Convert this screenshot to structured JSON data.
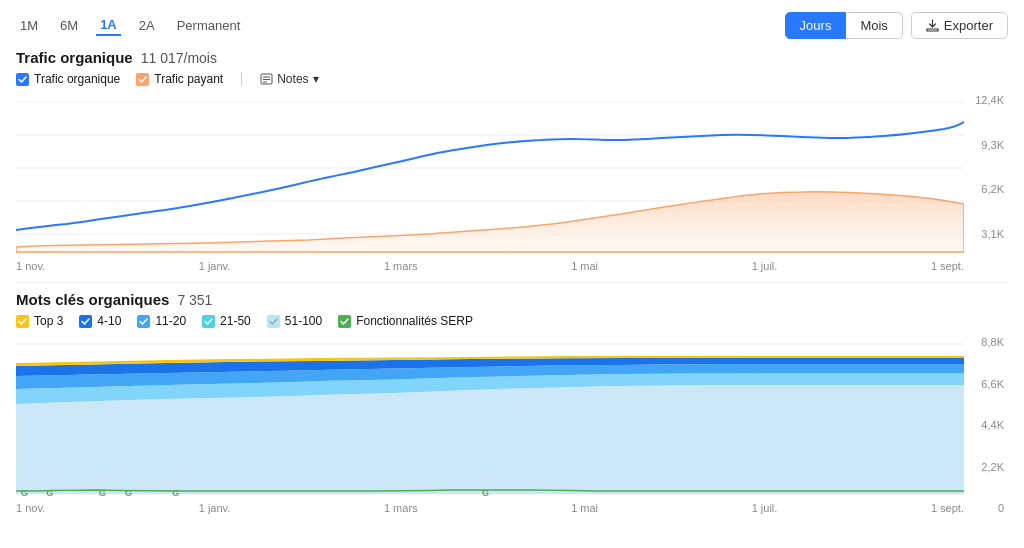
{
  "timeFilters": [
    "1M",
    "6M",
    "1A",
    "2A",
    "Permanent"
  ],
  "activeFilter": "1A",
  "controls": {
    "jours": "Jours",
    "mois": "Mois",
    "export": "Exporter"
  },
  "section1": {
    "title": "Trafic organique",
    "value": "11 017/mois",
    "legend": [
      {
        "label": "Trafic organique",
        "color": "blue"
      },
      {
        "label": "Trafic payant",
        "color": "orange"
      },
      {
        "label": "Notes",
        "hasDropdown": true
      }
    ],
    "yAxis": [
      "12,4K",
      "9,3K",
      "6,2K",
      "3,1K",
      ""
    ],
    "xAxis": [
      "1 nov.",
      "1 janv.",
      "1 mars",
      "1 mai",
      "1 juil.",
      "1 sept."
    ]
  },
  "section2": {
    "title": "Mots clés organiques",
    "value": "7 351",
    "legend": [
      {
        "label": "Top 3",
        "color": "yellow"
      },
      {
        "label": "4-10",
        "color": "darkblue"
      },
      {
        "label": "11-20",
        "color": "blue2"
      },
      {
        "label": "21-50",
        "color": "teal"
      },
      {
        "label": "51-100",
        "color": "lightblue"
      },
      {
        "label": "Fonctionnalités SERP",
        "color": "green"
      }
    ],
    "yAxis": [
      "8,8K",
      "6,6K",
      "4,4K",
      "2,2K",
      "0"
    ],
    "xAxis": [
      "1 nov.",
      "1 janv.",
      "1 mars",
      "1 mai",
      "1 juil.",
      "1 sept."
    ]
  }
}
